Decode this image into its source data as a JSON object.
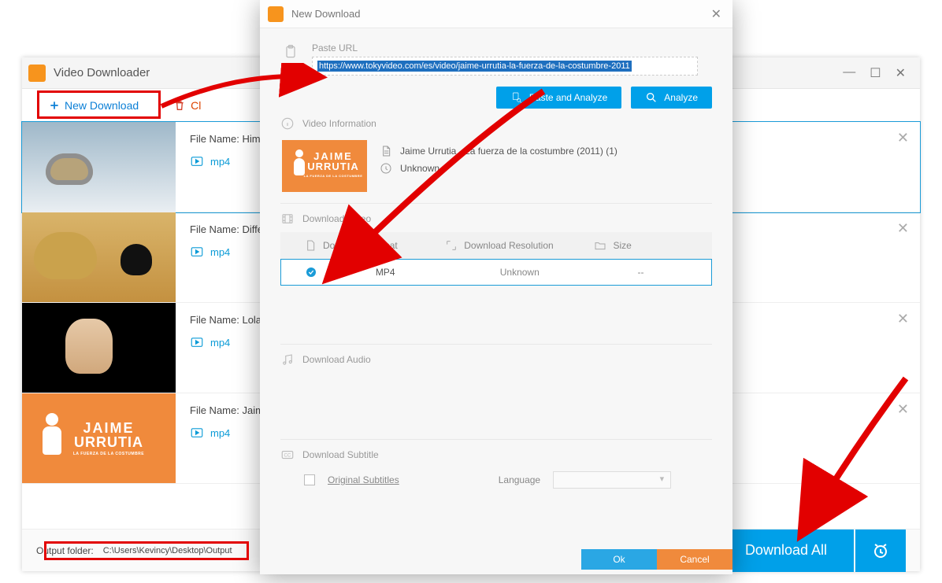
{
  "app": {
    "title": "Video Downloader"
  },
  "toolbar": {
    "new_download": "New Download",
    "clear_prefix": "Cl"
  },
  "list": [
    {
      "file_name": "File Name: Himala",
      "format": "mp4"
    },
    {
      "file_name": "File Name: Differe",
      "format": "mp4"
    },
    {
      "file_name": "File Name: Lola Ir",
      "format": "mp4"
    },
    {
      "file_name": "File Name: Jaime",
      "format": "mp4"
    }
  ],
  "footer": {
    "output_label": "Output folder:",
    "output_path": "C:\\Users\\Kevincy\\Desktop\\Output",
    "download_all": "Download All"
  },
  "dialog": {
    "title": "New Download",
    "paste_url_label": "Paste URL",
    "url": "https://www.tokyvideo.com/es/video/jaime-urrutia-la-fuerza-de-la-costumbre-2011",
    "paste_analyze": "Paste and Analyze",
    "analyze": "Analyze",
    "video_info_label": "Video Information",
    "video_title": "Jaime Urrutia - La fuerza de la costumbre (2011) (1)",
    "video_duration": "Unknown",
    "download_video_label": "Download Video",
    "col_format": "Download Format",
    "col_resolution": "Download Resolution",
    "col_size": "Size",
    "row_format": "MP4",
    "row_resolution": "Unknown",
    "row_size": "--",
    "download_audio_label": "Download Audio",
    "download_subtitle_label": "Download Subtitle",
    "original_subtitles": "Original Subtitles",
    "language_label": "Language",
    "ok": "Ok",
    "cancel": "Cancel",
    "thumb": {
      "line1": "JAIME",
      "line2": "URRUTIA",
      "sub": "LA FUERZA DE LA COSTUMBRE"
    }
  }
}
